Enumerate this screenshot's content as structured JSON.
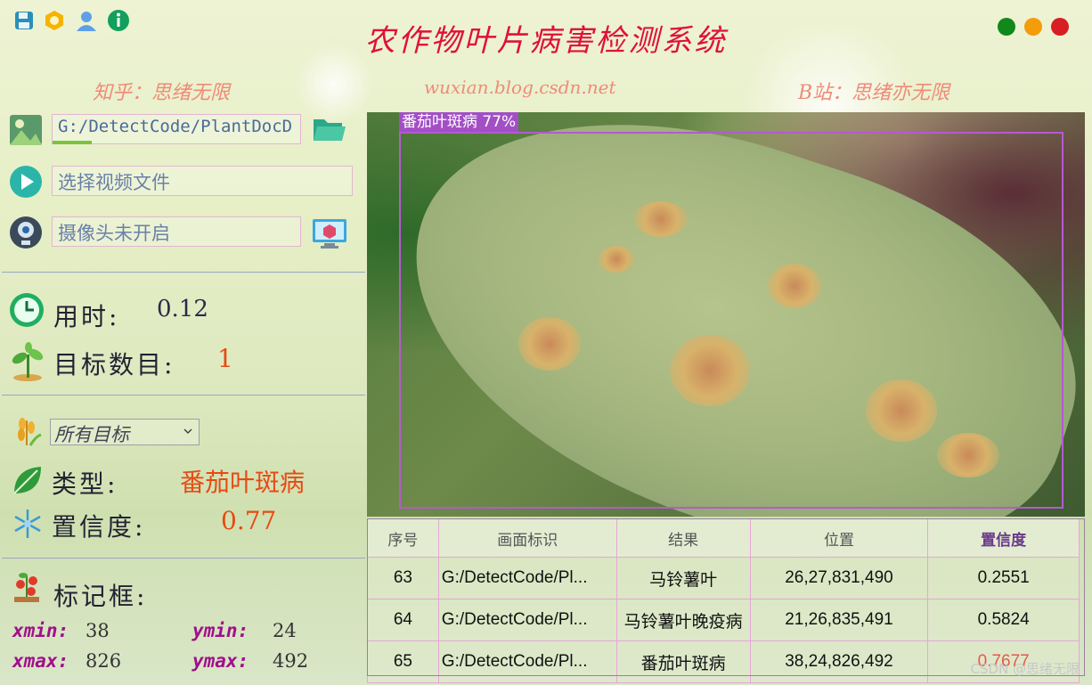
{
  "header": {
    "title": "农作物叶片病害检测系统",
    "zhihu": "知乎：思绪无限",
    "blog": "wuxian.blog.csdn.net",
    "bilibili": "B站：思绪亦无限",
    "icons": [
      "save-icon",
      "settings-icon",
      "user-icon",
      "info-icon"
    ],
    "window_buttons": {
      "minimize": "#11881a",
      "maximize": "#f59c0a",
      "close": "#d81e22"
    }
  },
  "inputs": {
    "image_path": "G:/DetectCode/PlantDocD",
    "video_placeholder": "选择视频文件",
    "camera_status": "摄像头未开启"
  },
  "stats": {
    "time_label": "用时:",
    "time_value": "0.12",
    "count_label": "目标数目:",
    "count_value": "1"
  },
  "filter": {
    "selected": "所有目标"
  },
  "result": {
    "type_label": "类型:",
    "type_value": "番茄叶斑病",
    "conf_label": "置信度:",
    "conf_value": "0.77"
  },
  "bbox_info": {
    "label": "标记框:",
    "xmin_label": "xmin:",
    "xmin": "38",
    "ymin_label": "ymin:",
    "ymin": "24",
    "xmax_label": "xmax:",
    "xmax": "826",
    "ymax_label": "ymax:",
    "ymax": "492"
  },
  "detection": {
    "label": "番茄叶斑病 77%"
  },
  "table": {
    "headers": [
      "序号",
      "画面标识",
      "结果",
      "位置",
      "置信度"
    ],
    "rows": [
      {
        "id": "63",
        "source": "G:/DetectCode/Pl...",
        "result": "马铃薯叶",
        "position": "26,27,831,490",
        "confidence": "0.2551"
      },
      {
        "id": "64",
        "source": "G:/DetectCode/Pl...",
        "result": "马铃薯叶晚疫病",
        "position": "21,26,835,491",
        "confidence": "0.5824"
      },
      {
        "id": "65",
        "source": "G:/DetectCode/Pl...",
        "result": "番茄叶斑病",
        "position": "38,24,826,492",
        "confidence": "0.7677"
      }
    ]
  },
  "watermark": "CSDN @思绪无限"
}
